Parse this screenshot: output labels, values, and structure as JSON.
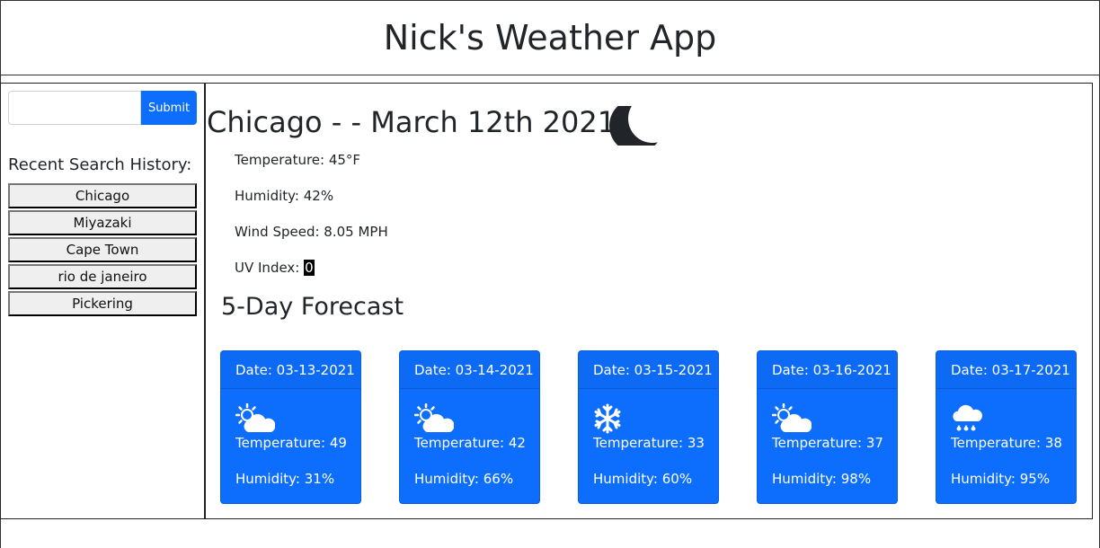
{
  "header": {
    "title": "Nick's Weather App"
  },
  "search": {
    "placeholder": "",
    "value": "",
    "submit_label": "Submit"
  },
  "history": {
    "title": "Recent Search History:",
    "items": [
      "Chicago",
      "Miyazaki",
      "Cape Town",
      "rio de janeiro",
      "Pickering"
    ]
  },
  "current": {
    "title": "Chicago - - March 12th 2021 --",
    "icon": "moon-icon",
    "temperature": "Temperature: 45°F",
    "humidity": "Humidity: 42%",
    "wind": "Wind Speed: 8.05 MPH",
    "uv_label": "UV Index: ",
    "uv_value": "0"
  },
  "forecast": {
    "title": "5-Day Forecast",
    "days": [
      {
        "date": "Date: 03-13-2021",
        "icon": "partly-cloudy-icon",
        "temp": "Temperature: 49",
        "humidity": "Humidity: 31%"
      },
      {
        "date": "Date: 03-14-2021",
        "icon": "partly-cloudy-icon",
        "temp": "Temperature: 42",
        "humidity": "Humidity: 66%"
      },
      {
        "date": "Date: 03-15-2021",
        "icon": "snowflake-icon",
        "temp": "Temperature: 33",
        "humidity": "Humidity: 60%"
      },
      {
        "date": "Date: 03-16-2021",
        "icon": "partly-cloudy-icon",
        "temp": "Temperature: 37",
        "humidity": "Humidity: 98%"
      },
      {
        "date": "Date: 03-17-2021",
        "icon": "rain-cloud-icon",
        "temp": "Temperature: 38",
        "humidity": "Humidity: 95%"
      }
    ]
  },
  "colors": {
    "accent": "#0d6efd",
    "text": "#212529"
  }
}
